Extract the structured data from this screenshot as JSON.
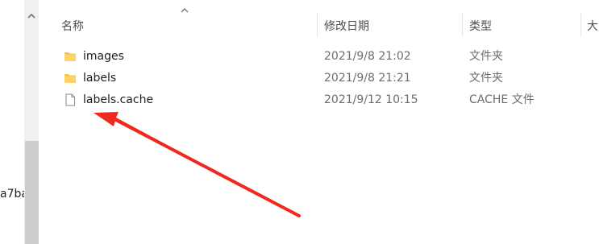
{
  "nav": {
    "partial_item": "a7ba"
  },
  "columns": {
    "name": "名称",
    "modified": "修改日期",
    "type": "类型",
    "size": "大"
  },
  "files": [
    {
      "name": "images",
      "modified": "2021/9/8 21:02",
      "type": "文件夹",
      "icon": "folder-icon"
    },
    {
      "name": "labels",
      "modified": "2021/9/8 21:21",
      "type": "文件夹",
      "icon": "folder-icon"
    },
    {
      "name": "labels.cache",
      "modified": "2021/9/12 10:15",
      "type": "CACHE 文件",
      "icon": "file-icon"
    }
  ],
  "colors": {
    "annotation": "#f0281e",
    "folder": "#f7c447",
    "scrollbar_thumb": "#cdcdcd"
  }
}
